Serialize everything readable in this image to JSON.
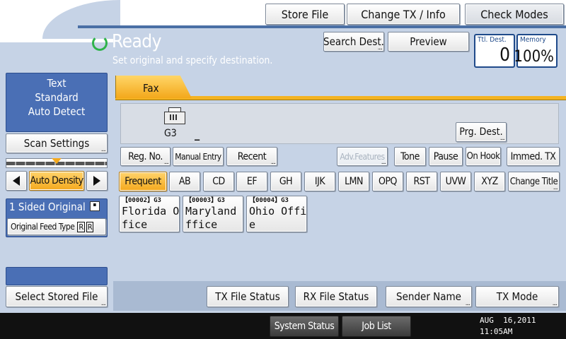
{
  "top_buttons": {
    "store_file": "Store File",
    "change_tx": "Change TX / Info",
    "check_modes": "Check Modes"
  },
  "status": {
    "state": "Ready",
    "message": "Set original and specify destination.",
    "search_dest": "Search Dest.",
    "preview": "Preview",
    "ttl_dest_label": "Ttl. Dest.",
    "ttl_dest_value": "0",
    "memory_label": "Memory",
    "memory_value": "100%"
  },
  "left_panel": {
    "mode_lines": [
      "Text",
      "Standard",
      "Auto Detect"
    ],
    "scan_settings": "Scan Settings",
    "auto_density": "Auto Density",
    "original": "1 Sided Original",
    "feed_type": "Original Feed Type",
    "select_stored": "Select Stored File"
  },
  "tab": {
    "fax": "Fax"
  },
  "dest_area": {
    "line_type": "G3",
    "cursor": "_",
    "prg_dest": "Prg. Dest."
  },
  "func_buttons": {
    "reg_no": "Reg. No.",
    "manual_entry": "Manual Entry",
    "recent": "Recent",
    "adv_features": "Adv.Features",
    "tone": "Tone",
    "pause": "Pause",
    "on_hook": "On Hook",
    "immed_tx": "Immed. TX"
  },
  "index_tabs": [
    "Frequent",
    "AB",
    "CD",
    "EF",
    "GH",
    "IJK",
    "LMN",
    "OPQ",
    "RST",
    "UVW",
    "XYZ"
  ],
  "change_title": "Change Title",
  "destinations": [
    {
      "code": "【00002】",
      "type": "G3",
      "line1": "Florida Of",
      "line2": "fice"
    },
    {
      "code": "【00003】",
      "type": "G3",
      "line1": "Maryland O",
      "line2": "ffice"
    },
    {
      "code": "【00004】",
      "type": "G3",
      "line1": "Ohio Offic",
      "line2": "e"
    }
  ],
  "bottom_buttons": {
    "tx_file_status": "TX File Status",
    "rx_file_status": "RX File Status",
    "sender_name": "Sender Name",
    "tx_mode": "TX Mode"
  },
  "footer": {
    "system_status": "System Status",
    "job_list": "Job List",
    "date": "AUG  16,2011",
    "time": "11:05AM"
  }
}
